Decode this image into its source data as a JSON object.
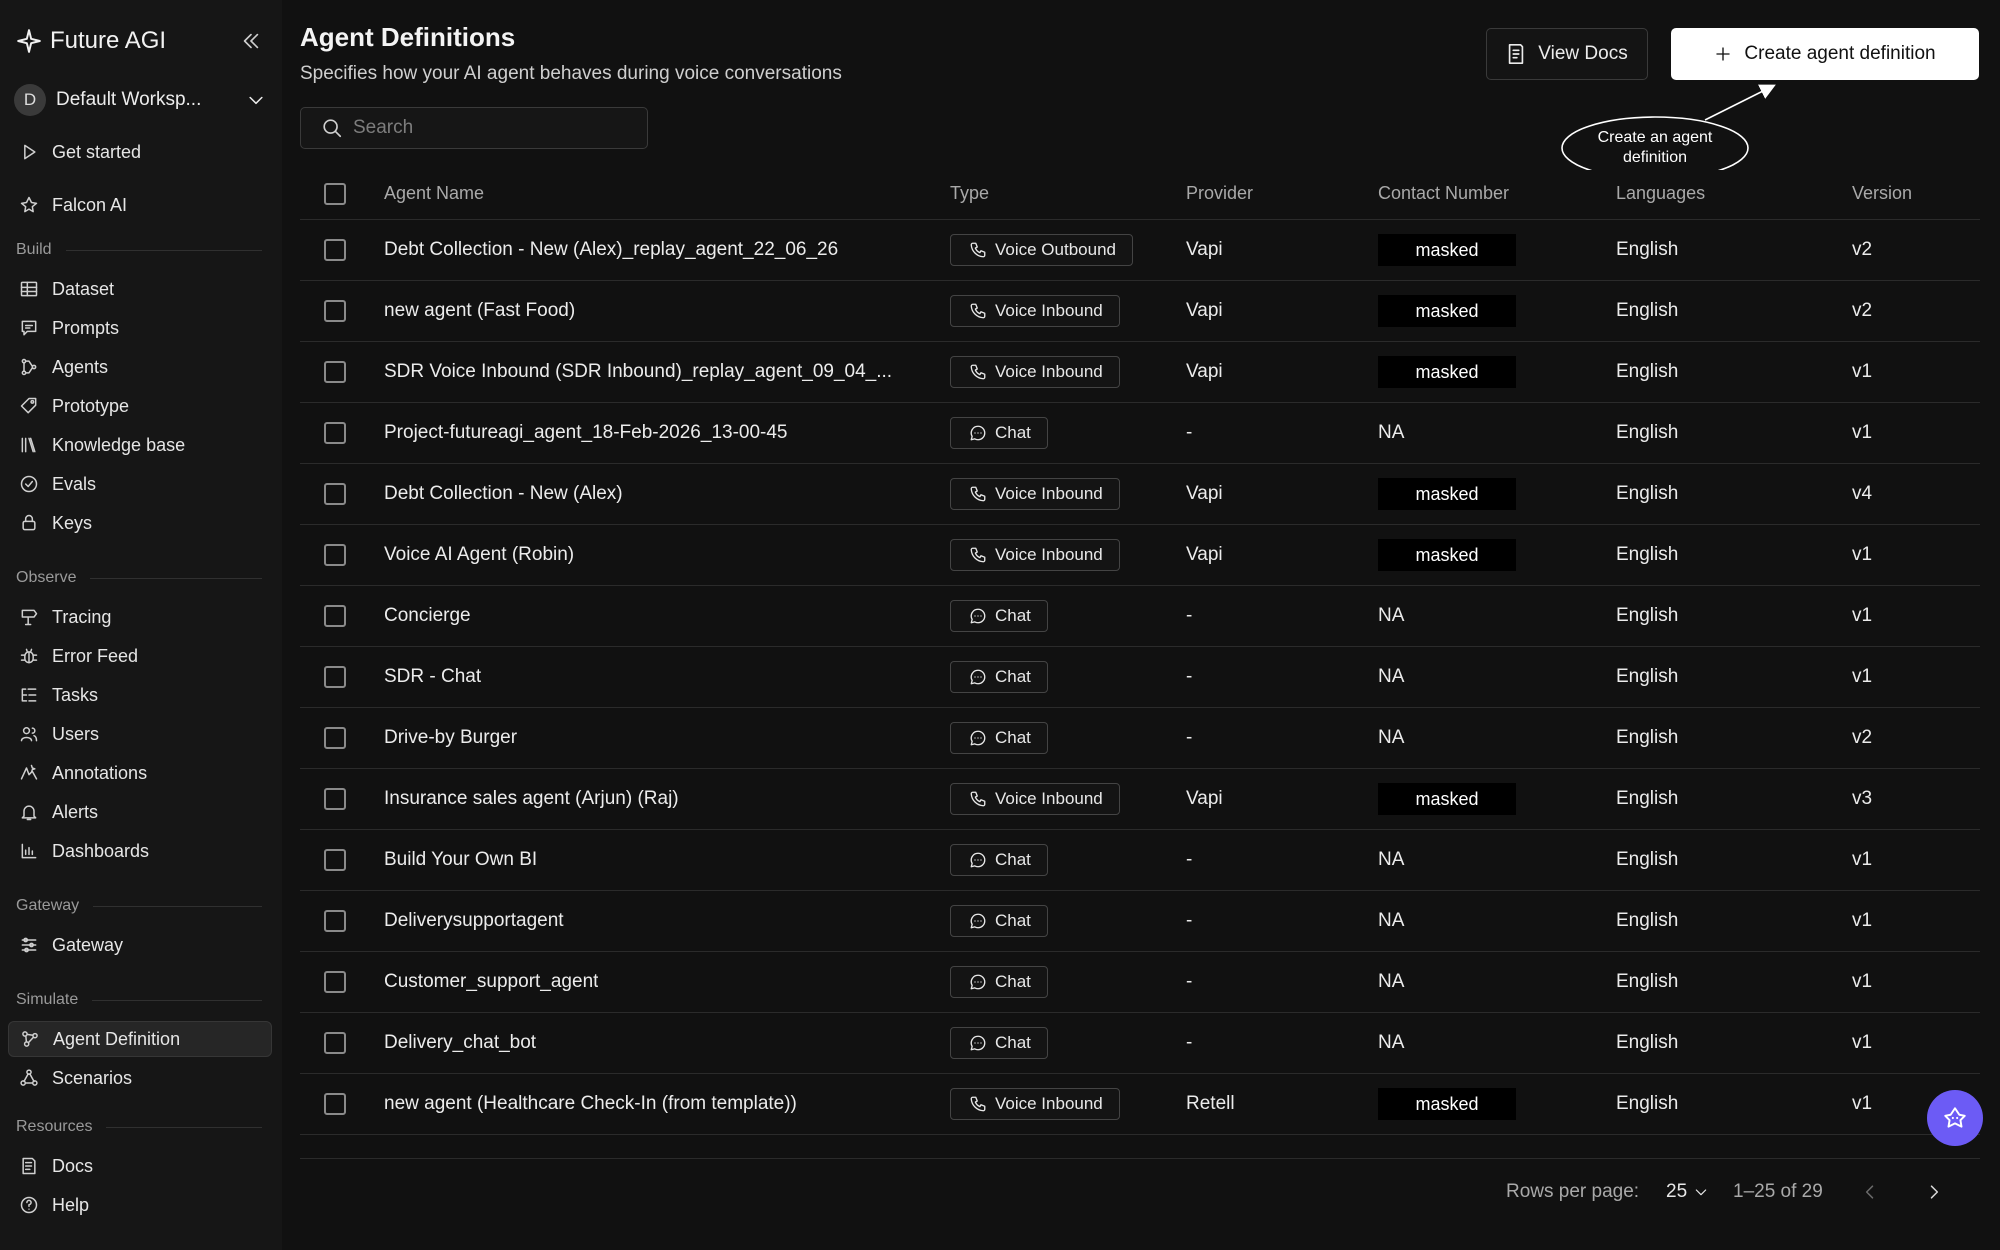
{
  "brand": {
    "name": "Future AGI"
  },
  "workspace": {
    "initial": "D",
    "name": "Default Worksp..."
  },
  "nav": {
    "top": [
      {
        "id": "get-started",
        "label": "Get started",
        "icon": "play-icon"
      },
      {
        "id": "falcon-ai",
        "label": "Falcon AI",
        "icon": "falcon-icon"
      }
    ],
    "sections": [
      {
        "title": "Build",
        "items": [
          {
            "id": "dataset",
            "label": "Dataset",
            "icon": "table-icon"
          },
          {
            "id": "prompts",
            "label": "Prompts",
            "icon": "message-icon"
          },
          {
            "id": "agents",
            "label": "Agents",
            "icon": "flow-icon"
          },
          {
            "id": "prototype",
            "label": "Prototype",
            "icon": "tag-icon"
          },
          {
            "id": "knowledge-base",
            "label": "Knowledge base",
            "icon": "library-icon"
          },
          {
            "id": "evals",
            "label": "Evals",
            "icon": "check-circle-icon"
          },
          {
            "id": "keys",
            "label": "Keys",
            "icon": "lock-icon"
          }
        ]
      },
      {
        "title": "Observe",
        "items": [
          {
            "id": "tracing",
            "label": "Tracing",
            "icon": "signpost-icon"
          },
          {
            "id": "error-feed",
            "label": "Error Feed",
            "icon": "bug-icon"
          },
          {
            "id": "tasks",
            "label": "Tasks",
            "icon": "tasks-icon"
          },
          {
            "id": "users",
            "label": "Users",
            "icon": "users-icon"
          },
          {
            "id": "annotations",
            "label": "Annotations",
            "icon": "sparkle-icon"
          },
          {
            "id": "alerts",
            "label": "Alerts",
            "icon": "bell-icon"
          },
          {
            "id": "dashboards",
            "label": "Dashboards",
            "icon": "bar-chart-icon"
          }
        ]
      },
      {
        "title": "Gateway",
        "items": [
          {
            "id": "gateway",
            "label": "Gateway",
            "icon": "sliders-icon"
          }
        ]
      },
      {
        "title": "Simulate",
        "items": [
          {
            "id": "agent-definition",
            "label": "Agent Definition",
            "icon": "nodes-icon",
            "active": true
          },
          {
            "id": "scenarios",
            "label": "Scenarios",
            "icon": "share-icon"
          }
        ]
      },
      {
        "title": "Resources",
        "items": [
          {
            "id": "docs",
            "label": "Docs",
            "icon": "document-icon"
          },
          {
            "id": "help",
            "label": "Help",
            "icon": "help-icon"
          }
        ]
      }
    ]
  },
  "header": {
    "title": "Agent Definitions",
    "subtitle": "Specifies how your AI agent behaves during voice conversations",
    "view_docs": "View Docs",
    "create": "Create agent definition",
    "annotation": "Create an agent definition"
  },
  "search": {
    "placeholder": "Search"
  },
  "table": {
    "columns": {
      "name": "Agent Name",
      "type": "Type",
      "provider": "Provider",
      "contact": "Contact Number",
      "languages": "Languages",
      "version": "Version"
    },
    "rows": [
      {
        "name": "Debt Collection - New (Alex)_replay_agent_22_06_26",
        "type": "Voice Outbound",
        "provider": "Vapi",
        "contact": "masked",
        "language": "English",
        "version": "v2"
      },
      {
        "name": "new agent (Fast Food)",
        "type": "Voice Inbound",
        "provider": "Vapi",
        "contact": "masked",
        "language": "English",
        "version": "v2"
      },
      {
        "name": "SDR Voice Inbound (SDR Inbound)_replay_agent_09_04_...",
        "type": "Voice Inbound",
        "provider": "Vapi",
        "contact": "masked",
        "language": "English",
        "version": "v1"
      },
      {
        "name": "Project-futureagi_agent_18-Feb-2026_13-00-45",
        "type": "Chat",
        "provider": "-",
        "contact": "NA",
        "language": "English",
        "version": "v1"
      },
      {
        "name": "Debt Collection - New (Alex)",
        "type": "Voice Inbound",
        "provider": "Vapi",
        "contact": "masked",
        "language": "English",
        "version": "v4"
      },
      {
        "name": "Voice AI Agent (Robin)",
        "type": "Voice Inbound",
        "provider": "Vapi",
        "contact": "masked",
        "language": "English",
        "version": "v1"
      },
      {
        "name": "Concierge",
        "type": "Chat",
        "provider": "-",
        "contact": "NA",
        "language": "English",
        "version": "v1"
      },
      {
        "name": "SDR - Chat",
        "type": "Chat",
        "provider": "-",
        "contact": "NA",
        "language": "English",
        "version": "v1"
      },
      {
        "name": "Drive-by Burger",
        "type": "Chat",
        "provider": "-",
        "contact": "NA",
        "language": "English",
        "version": "v2"
      },
      {
        "name": "Insurance sales agent (Arjun) (Raj)",
        "type": "Voice Inbound",
        "provider": "Vapi",
        "contact": "masked",
        "language": "English",
        "version": "v3"
      },
      {
        "name": "Build Your Own BI",
        "type": "Chat",
        "provider": "-",
        "contact": "NA",
        "language": "English",
        "version": "v1"
      },
      {
        "name": "Deliverysupportagent",
        "type": "Chat",
        "provider": "-",
        "contact": "NA",
        "language": "English",
        "version": "v1"
      },
      {
        "name": "Customer_support_agent",
        "type": "Chat",
        "provider": "-",
        "contact": "NA",
        "language": "English",
        "version": "v1"
      },
      {
        "name": "Delivery_chat_bot",
        "type": "Chat",
        "provider": "-",
        "contact": "NA",
        "language": "English",
        "version": "v1"
      },
      {
        "name": "new agent (Healthcare Check-In (from template))",
        "type": "Voice Inbound",
        "provider": "Retell",
        "contact": "masked",
        "language": "English",
        "version": "v1"
      }
    ]
  },
  "pagination": {
    "rows_label": "Rows per page:",
    "rows_value": "25",
    "range": "1–25 of 29"
  }
}
